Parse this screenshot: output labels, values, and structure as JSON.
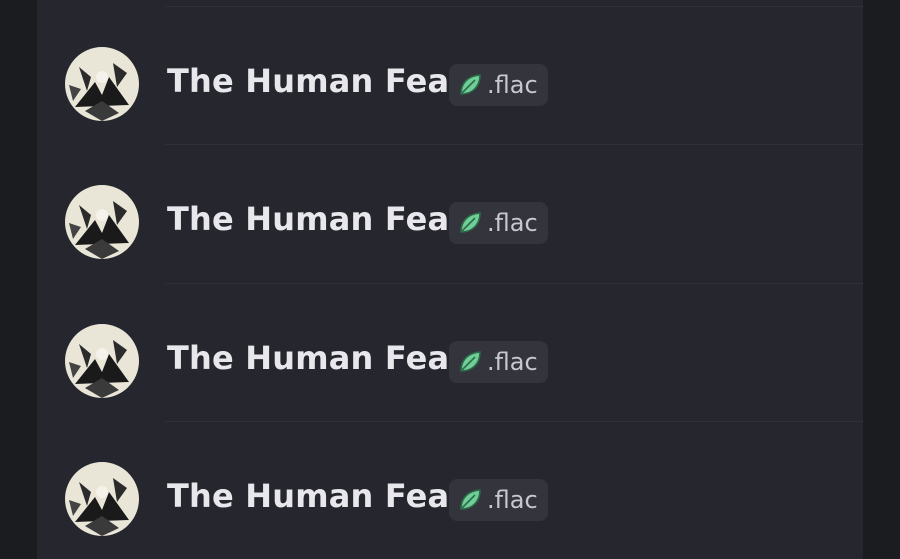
{
  "items": [
    {
      "title": "The Human Fear",
      "tag": ".flac",
      "tag_icon": "leaf-icon"
    },
    {
      "title": "The Human Fear",
      "tag": ".flac",
      "tag_icon": "leaf-icon"
    },
    {
      "title": "The Human Fear",
      "tag": ".flac",
      "tag_icon": "leaf-icon"
    },
    {
      "title": "The Human Fear",
      "tag": ".flac",
      "tag_icon": "leaf-icon"
    }
  ],
  "colors": {
    "background": "#25262e",
    "tag_background": "#33343c",
    "leaf": "#6fcf97",
    "title": "#e8e8ec"
  }
}
